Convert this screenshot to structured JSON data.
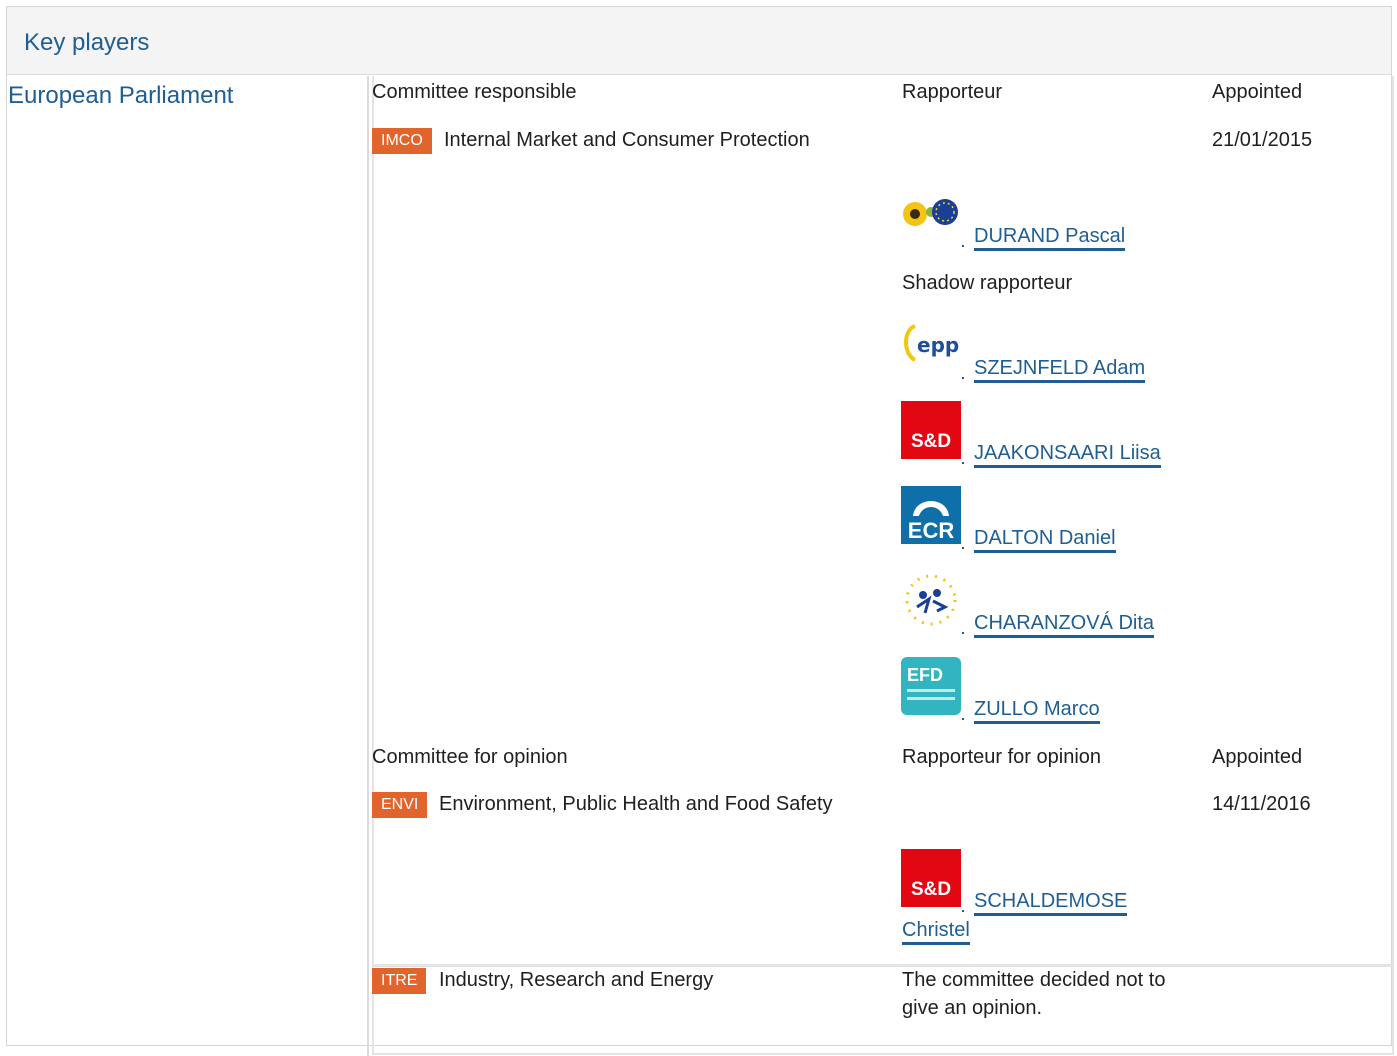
{
  "header": {
    "title": "Key players"
  },
  "institution": "European Parliament",
  "responsible": {
    "heading_committee": "Committee responsible",
    "heading_rapporteur": "Rapporteur",
    "heading_appointed": "Appointed",
    "committee_code": "IMCO",
    "committee_name": "Internal Market and Consumer Protection",
    "appointed": "21/01/2015",
    "rapporteur": {
      "name": "DURAND Pascal",
      "group_icon": "greens-efa-logo-icon"
    },
    "shadow_label": "Shadow rapporteur",
    "shadows": [
      {
        "name": "SZEJNFELD Adam",
        "group_icon": "epp-logo-icon"
      },
      {
        "name": "JAAKONSAARI Liisa",
        "group_icon": "sd-logo-icon",
        "logo_text": "S&D"
      },
      {
        "name": "DALTON Daniel",
        "group_icon": "ecr-logo-icon",
        "logo_text": "ECR"
      },
      {
        "name": "CHARANZOVÁ Dita",
        "group_icon": "alde-logo-icon"
      },
      {
        "name": "ZULLO Marco",
        "group_icon": "efdd-logo-icon",
        "logo_text": "EFD"
      }
    ]
  },
  "opinion": {
    "heading_committee": "Committee for opinion",
    "heading_rapporteur": "Rapporteur for opinion",
    "heading_appointed": "Appointed",
    "committees": [
      {
        "code": "ENVI",
        "name": "Environment, Public Health and Food Safety",
        "appointed": "14/11/2016",
        "rapporteur_line1": "SCHALDEMOSE",
        "rapporteur_line2": "Christel",
        "group_icon": "sd-logo-icon",
        "logo_text": "S&D"
      },
      {
        "code": "ITRE",
        "name": "Industry, Research and Energy",
        "note_line1": "The committee decided not to",
        "note_line2": "give an opinion."
      }
    ]
  },
  "colors": {
    "link": "#1e5e94",
    "badge": "#e0642c",
    "sd_red": "#e30613",
    "ecr_blue": "#0f6fa8",
    "efdd_teal": "#32b5c0"
  }
}
